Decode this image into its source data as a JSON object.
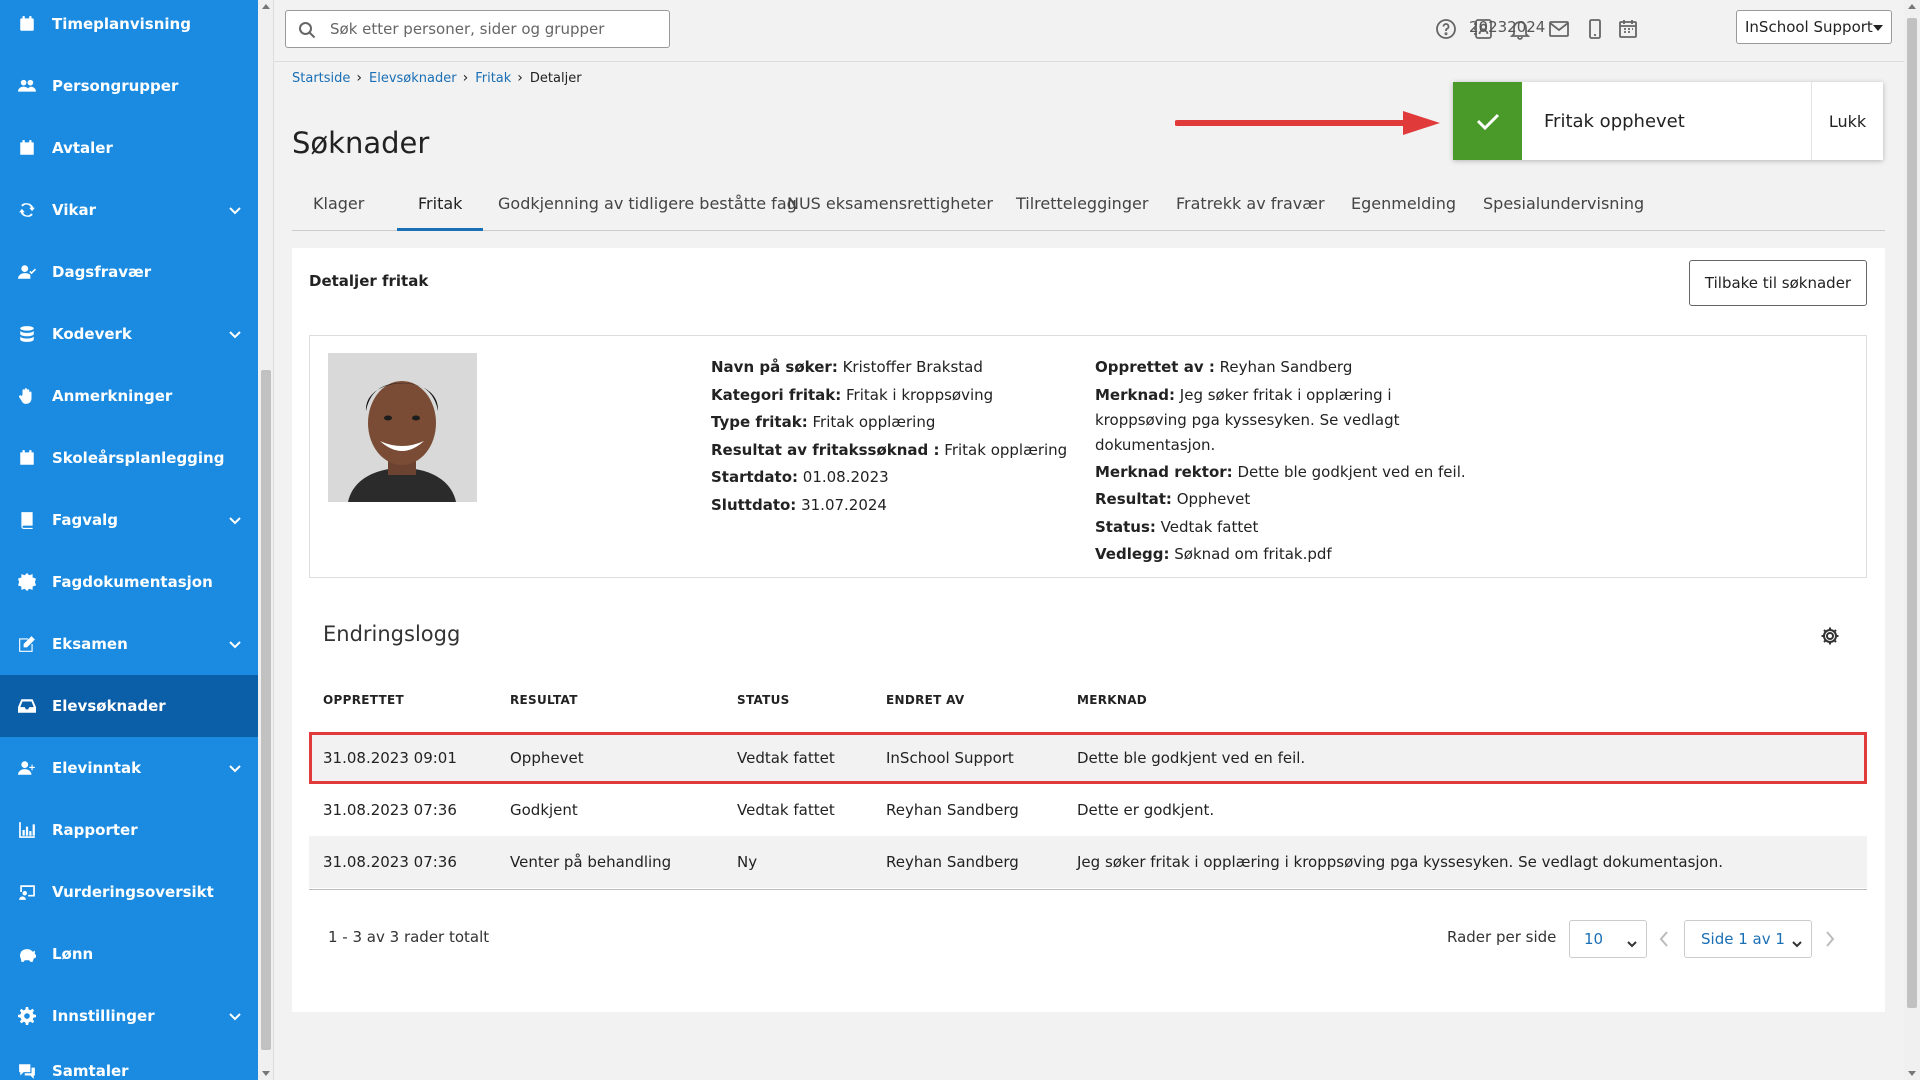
{
  "sidebar": {
    "items": [
      {
        "label": "Timeplanvisning",
        "icon": "calendar-icon",
        "chevron": false,
        "active": false
      },
      {
        "label": "Persongrupper",
        "icon": "users-icon",
        "chevron": false,
        "active": false
      },
      {
        "label": "Avtaler",
        "icon": "calendar-check-icon",
        "chevron": false,
        "active": false
      },
      {
        "label": "Vikar",
        "icon": "sync-icon",
        "chevron": true,
        "active": false
      },
      {
        "label": "Dagsfravær",
        "icon": "user-check-icon",
        "chevron": false,
        "active": false
      },
      {
        "label": "Kodeverk",
        "icon": "database-icon",
        "chevron": true,
        "active": false
      },
      {
        "label": "Anmerkninger",
        "icon": "hand-icon",
        "chevron": false,
        "active": false
      },
      {
        "label": "Skoleårsplanlegging",
        "icon": "calendar-grid-icon",
        "chevron": false,
        "active": false
      },
      {
        "label": "Fagvalg",
        "icon": "book-icon",
        "chevron": true,
        "active": false
      },
      {
        "label": "Fagdokumentasjon",
        "icon": "badge-icon",
        "chevron": false,
        "active": false
      },
      {
        "label": "Eksamen",
        "icon": "pen-icon",
        "chevron": true,
        "active": false
      },
      {
        "label": "Elevsøknader",
        "icon": "inbox-icon",
        "chevron": false,
        "active": true
      },
      {
        "label": "Elevinntak",
        "icon": "user-plus-icon",
        "chevron": true,
        "active": false
      },
      {
        "label": "Rapporter",
        "icon": "chart-icon",
        "chevron": false,
        "active": false
      },
      {
        "label": "Vurderingsoversikt",
        "icon": "chalkboard-icon",
        "chevron": false,
        "active": false
      },
      {
        "label": "Lønn",
        "icon": "piggy-bank-icon",
        "chevron": false,
        "active": false
      },
      {
        "label": "Innstillinger",
        "icon": "gear-icon",
        "chevron": true,
        "active": false
      },
      {
        "label": "Samtaler",
        "icon": "chat-icon",
        "chevron": false,
        "active": false
      }
    ]
  },
  "topbar": {
    "search_placeholder": "Søk etter personer, sider og grupper",
    "school_year": "20232024",
    "user_name": "InSchool Support"
  },
  "breadcrumb": [
    {
      "label": "Startside",
      "link": true
    },
    {
      "label": "Elevsøknader",
      "link": true
    },
    {
      "label": "Fritak",
      "link": true
    },
    {
      "label": "Detaljer",
      "link": false
    }
  ],
  "page_title": "Søknader",
  "tabs": [
    {
      "label": "Klager",
      "active": false
    },
    {
      "label": "Fritak",
      "active": true
    },
    {
      "label": "Godkjenning av tidligere beståtte fag",
      "active": false
    },
    {
      "label": "NUS eksamensrettigheter",
      "active": false
    },
    {
      "label": "Tilrettelegginger",
      "active": false
    },
    {
      "label": "Fratrekk av fravær",
      "active": false
    },
    {
      "label": "Egenmelding",
      "active": false
    },
    {
      "label": "Spesialundervisning",
      "active": false
    }
  ],
  "toast": {
    "message": "Fritak opphevet",
    "close_label": "Lukk",
    "color": "#4a9a2a"
  },
  "details": {
    "title": "Detaljer fritak",
    "back_button": "Tilbake til søknader",
    "left_fields": [
      {
        "label": "Navn på søker:",
        "value": "Kristoffer Brakstad"
      },
      {
        "label": "Kategori fritak:",
        "value": "Fritak i kroppsøving"
      },
      {
        "label": "Type fritak:",
        "value": "Fritak opplæring"
      },
      {
        "label": "Resultat av fritakssøknad :",
        "value": "Fritak opplæring"
      },
      {
        "label": "Startdato:",
        "value": "01.08.2023"
      },
      {
        "label": "Sluttdato:",
        "value": "31.07.2024"
      }
    ],
    "right_fields": [
      {
        "label": "Opprettet av :",
        "value": "Reyhan Sandberg"
      },
      {
        "label": "Merknad:",
        "value": "Jeg søker fritak i opplæring i kroppsøving pga kyssesyken. Se vedlagt dokumentasjon."
      },
      {
        "label": "Merknad rektor:",
        "value": "Dette ble godkjent ved en feil."
      },
      {
        "label": "Resultat:",
        "value": "Opphevet"
      },
      {
        "label": "Status:",
        "value": "Vedtak fattet"
      },
      {
        "label": "Vedlegg:",
        "value": "Søknad om fritak.pdf"
      }
    ]
  },
  "log": {
    "title": "Endringslogg",
    "columns": [
      "OPPRETTET",
      "RESULTAT",
      "STATUS",
      "ENDRET AV",
      "MERKNAD"
    ],
    "rows": [
      [
        "31.08.2023 09:01",
        "Opphevet",
        "Vedtak fattet",
        "InSchool Support",
        "Dette ble godkjent ved en feil."
      ],
      [
        "31.08.2023 07:36",
        "Godkjent",
        "Vedtak fattet",
        "Reyhan Sandberg",
        "Dette er godkjent."
      ],
      [
        "31.08.2023 07:36",
        "Venter på behandling",
        "Ny",
        "Reyhan Sandberg",
        "Jeg søker fritak i opplæring i kroppsøving pga kyssesyken. Se vedlagt dokumentasjon."
      ]
    ],
    "row_count": "1 - 3 av 3 rader totalt",
    "rows_per_page_label": "Rader per side",
    "rows_per_page": "10",
    "page_label": "Side 1 av 1"
  },
  "colors": {
    "sidebar": "#1a8be0",
    "sidebar_active": "#0b5ea8",
    "link": "#1a6fb5",
    "highlight_border": "#e03a3a"
  }
}
